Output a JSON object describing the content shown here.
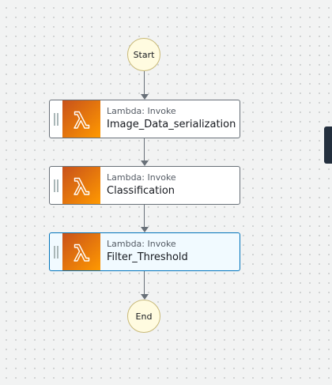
{
  "workflow": {
    "start_label": "Start",
    "end_label": "End",
    "states": [
      {
        "type": "Lambda: Invoke",
        "name": "Image_Data_serialization",
        "icon": "lambda-icon"
      },
      {
        "type": "Lambda: Invoke",
        "name": "Classification",
        "icon": "lambda-icon"
      },
      {
        "type": "Lambda: Invoke",
        "name": "Filter_Threshold",
        "icon": "lambda-icon"
      }
    ]
  },
  "colors": {
    "lambda_orange_dark": "#c8511b",
    "lambda_orange_light": "#ff9900",
    "selected_border": "#0073bb",
    "terminal_fill": "#fffbe0",
    "connector": "#687078"
  }
}
